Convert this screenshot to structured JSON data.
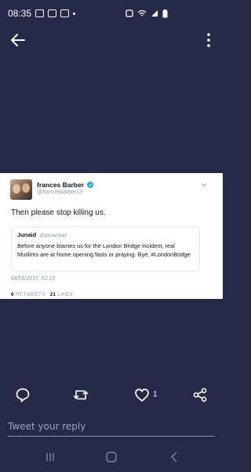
{
  "status_bar": {
    "time": "08:35"
  },
  "tweet": {
    "author_name": "frances Barber",
    "author_handle": "@francesbarber13",
    "text": "Then please stop killing us.",
    "quoted": {
      "author_name": "Junaid",
      "author_handle": "@ibrownlad",
      "text": "Before anyone blames us for the London Bridge incident, real Muslims are at home opening fasts or praying.  Bye. #LondonBridge"
    },
    "timestamp": "04/06/2017, 02:15",
    "retweets_count": "6",
    "retweets_label": "RETWEETS",
    "likes_count": "21",
    "likes_label": "LIKES"
  },
  "actions": {
    "like_count": "1"
  },
  "reply": {
    "placeholder": "Tweet your reply"
  },
  "colors": {
    "background": "#252a48",
    "card": "#ffffff",
    "verified": "#1da1f2"
  }
}
